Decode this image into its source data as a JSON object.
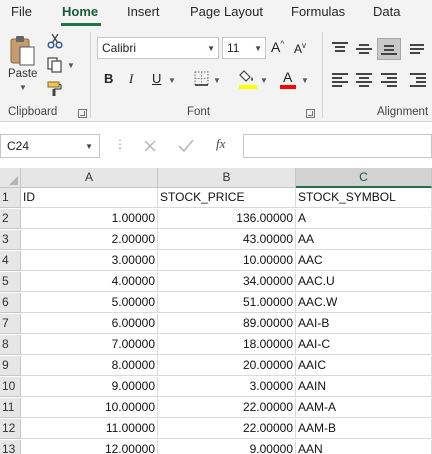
{
  "menu_tabs": [
    "File",
    "Home",
    "Insert",
    "Page Layout",
    "Formulas",
    "Data"
  ],
  "active_tab": "Home",
  "ribbon": {
    "clipboard": {
      "paste_label": "Paste",
      "group_label": "Clipboard",
      "icons": [
        "paste-icon",
        "cut-icon",
        "copy-icon",
        "format-painter-icon"
      ]
    },
    "font": {
      "font_name": "Calibri",
      "font_size": "11",
      "grow_label": "A",
      "shrink_label": "A",
      "bold_label": "B",
      "italic_label": "I",
      "underline_label": "U",
      "font_color_label": "A",
      "group_label": "Font",
      "fill_color": "#ffff00",
      "font_color": "#ff0000"
    },
    "alignment": {
      "group_label": "Alignment",
      "selected_button": "middle-align"
    }
  },
  "formula_bar": {
    "name_box": "C24",
    "fx_label": "fx",
    "formula": ""
  },
  "grid": {
    "columns": [
      "A",
      "B",
      "C"
    ],
    "selected_column": "C",
    "rows": [
      {
        "n": "1",
        "a": "ID",
        "b": "STOCK_PRICE",
        "c": "STOCK_SYMBOL"
      },
      {
        "n": "2",
        "a": "1.00000",
        "b": "136.00000",
        "c": "A"
      },
      {
        "n": "3",
        "a": "2.00000",
        "b": "43.00000",
        "c": "AA"
      },
      {
        "n": "4",
        "a": "3.00000",
        "b": "10.00000",
        "c": "AAC"
      },
      {
        "n": "5",
        "a": "4.00000",
        "b": "34.00000",
        "c": "AAC.U"
      },
      {
        "n": "6",
        "a": "5.00000",
        "b": "51.00000",
        "c": "AAC.W"
      },
      {
        "n": "7",
        "a": "6.00000",
        "b": "89.00000",
        "c": "AAI-B"
      },
      {
        "n": "8",
        "a": "7.00000",
        "b": "18.00000",
        "c": "AAI-C"
      },
      {
        "n": "9",
        "a": "8.00000",
        "b": "20.00000",
        "c": "AAIC"
      },
      {
        "n": "10",
        "a": "9.00000",
        "b": "3.00000",
        "c": "AAIN"
      },
      {
        "n": "11",
        "a": "10.00000",
        "b": "22.00000",
        "c": "AAM-A"
      },
      {
        "n": "12",
        "a": "11.00000",
        "b": "22.00000",
        "c": "AAM-B"
      },
      {
        "n": "13",
        "a": "12.00000",
        "b": "9.00000",
        "c": "AAN"
      }
    ]
  },
  "colors": {
    "accent": "#217346",
    "ribbon_bg": "#f3f3f3"
  }
}
